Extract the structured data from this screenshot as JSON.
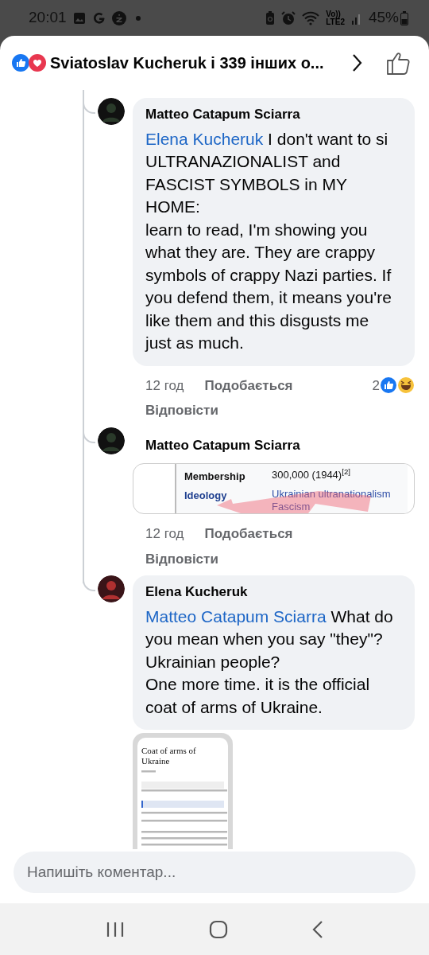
{
  "status_bar": {
    "time": "20:01",
    "volte": "Vo))",
    "network": "LTE2",
    "battery": "45%"
  },
  "header": {
    "title": "Sviatoslav Kucheruk і 339 інших о..."
  },
  "comments": [
    {
      "author": "Matteo Catapum Sciarra",
      "mention": "Elena Kucheruk",
      "text": "I don't want to si ULTRANAZIONALIST and FASCIST SYMBOLS in MY HOME:\nlearn to read, I'm showing you what they are. They are crappy symbols of crappy Nazi parties. If you defend them, it means you're like them and this disgusts me just as much.",
      "time": "12 год",
      "like": "Подобається",
      "reply": "Відповісти",
      "reactions_count": "2"
    },
    {
      "author": "Matteo Catapum Sciarra",
      "attachment": {
        "kind": "infobox",
        "rows": [
          {
            "label": "Membership",
            "value": "300,000 (1944)$^{[2]}$",
            "link": false
          },
          {
            "label": "Ideology",
            "value": "Ukrainian ultranationalism\nFascism",
            "link": true
          }
        ]
      },
      "time": "12 год",
      "like": "Подобається",
      "reply": "Відповісти"
    },
    {
      "author": "Elena Kucheruk",
      "mention": "Matteo Catapum Sciarra",
      "text": "What do you mean when you say \"they\"? Ukrainian people?\nOne more time. it is the official coat of arms of Ukraine.",
      "attachment": {
        "kind": "article",
        "title": "Coat of arms of Ukraine"
      }
    }
  ],
  "composer": {
    "placeholder": "Напишіть коментар..."
  }
}
